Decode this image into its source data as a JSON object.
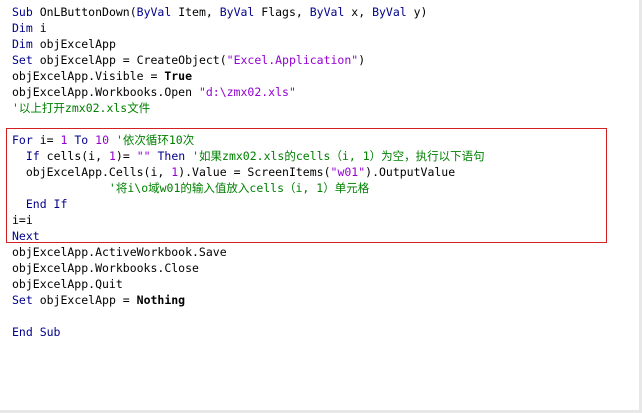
{
  "lines": [
    [
      {
        "t": "Sub",
        "c": "kw"
      },
      {
        "t": " OnLButtonDown(",
        "c": ""
      },
      {
        "t": "ByVal",
        "c": "kw"
      },
      {
        "t": " Item, ",
        "c": ""
      },
      {
        "t": "ByVal",
        "c": "kw"
      },
      {
        "t": " Flags, ",
        "c": ""
      },
      {
        "t": "ByVal",
        "c": "kw"
      },
      {
        "t": " x, ",
        "c": ""
      },
      {
        "t": "ByVal",
        "c": "kw"
      },
      {
        "t": " y)",
        "c": ""
      }
    ],
    [
      {
        "t": "Dim",
        "c": "kw"
      },
      {
        "t": " i",
        "c": ""
      }
    ],
    [
      {
        "t": "Dim",
        "c": "kw"
      },
      {
        "t": " objExcelApp",
        "c": ""
      }
    ],
    [
      {
        "t": "Set",
        "c": "kw"
      },
      {
        "t": " objExcelApp = CreateObject(",
        "c": ""
      },
      {
        "t": "\"Excel.Application\"",
        "c": "str"
      },
      {
        "t": ")",
        "c": ""
      }
    ],
    [
      {
        "t": "objExcelApp.Visible = ",
        "c": ""
      },
      {
        "t": "True",
        "c": "bold"
      }
    ],
    [
      {
        "t": "objExcelApp.Workbooks.Open ",
        "c": ""
      },
      {
        "t": "\"d:\\zmx02.xls\"",
        "c": "str"
      }
    ],
    [
      {
        "t": "'以上打开zmx02.xls文件",
        "c": "cm"
      }
    ],
    [],
    [
      {
        "t": "For",
        "c": "kw"
      },
      {
        "t": " i= ",
        "c": ""
      },
      {
        "t": "1",
        "c": "num"
      },
      {
        "t": " ",
        "c": ""
      },
      {
        "t": "To",
        "c": "kw"
      },
      {
        "t": " ",
        "c": ""
      },
      {
        "t": "10",
        "c": "num"
      },
      {
        "t": " '依次循环10次",
        "c": "cm"
      }
    ],
    [
      {
        "t": "  ",
        "c": ""
      },
      {
        "t": "If",
        "c": "kw"
      },
      {
        "t": " cells(i, ",
        "c": ""
      },
      {
        "t": "1",
        "c": "num"
      },
      {
        "t": ")= ",
        "c": ""
      },
      {
        "t": "\"\"",
        "c": "str"
      },
      {
        "t": " ",
        "c": ""
      },
      {
        "t": "Then",
        "c": "kw"
      },
      {
        "t": " '如果zmx02.xls的cells（i, 1）为空，执行以下语句",
        "c": "cm"
      }
    ],
    [
      {
        "t": "  objExcelApp.Cells(i, ",
        "c": ""
      },
      {
        "t": "1",
        "c": "num"
      },
      {
        "t": ").Value = ScreenItems(",
        "c": ""
      },
      {
        "t": "\"w01\"",
        "c": "str"
      },
      {
        "t": ").OutputValue",
        "c": ""
      }
    ],
    [
      {
        "t": "              '将i\\o域w01的输入值放入cells（i, 1）单元格",
        "c": "cm"
      }
    ],
    [
      {
        "t": "  ",
        "c": ""
      },
      {
        "t": "End If",
        "c": "kw"
      }
    ],
    [
      {
        "t": "i=i",
        "c": ""
      }
    ],
    [
      {
        "t": "Next",
        "c": "kw"
      }
    ],
    [
      {
        "t": "objExcelApp.ActiveWorkbook.Save",
        "c": ""
      }
    ],
    [
      {
        "t": "objExcelApp.Workbooks.Close",
        "c": ""
      }
    ],
    [
      {
        "t": "objExcelApp.Quit",
        "c": ""
      }
    ],
    [
      {
        "t": "Set",
        "c": "kw"
      },
      {
        "t": " objExcelApp = ",
        "c": ""
      },
      {
        "t": "Nothing",
        "c": "bold"
      }
    ],
    [],
    [
      {
        "t": "End Sub",
        "c": "kw"
      }
    ]
  ],
  "colors": {
    "keyword": "#00008b",
    "string": "#9400d3",
    "comment": "#008000",
    "highlight_border": "#d42020"
  }
}
